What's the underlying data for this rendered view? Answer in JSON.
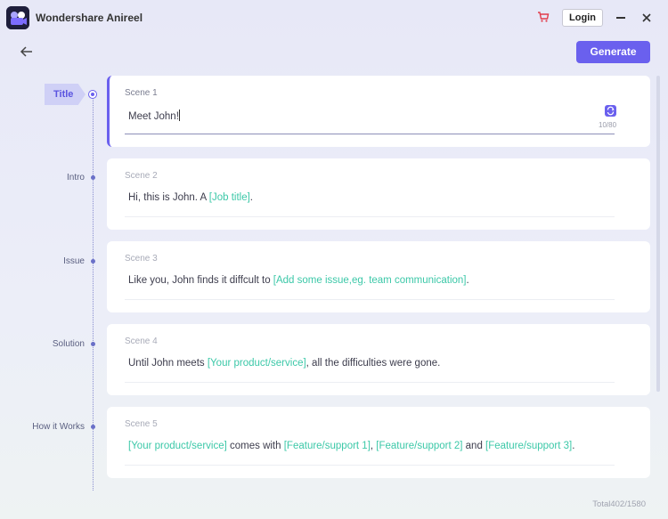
{
  "app": {
    "title": "Wondershare Anireel"
  },
  "header": {
    "login_label": "Login",
    "generate_label": "Generate"
  },
  "timeline": {
    "items": [
      {
        "label": "Title",
        "active": true
      },
      {
        "label": "Intro"
      },
      {
        "label": "Issue"
      },
      {
        "label": "Solution"
      },
      {
        "label": "How it Works"
      }
    ]
  },
  "scenes": [
    {
      "label": "Scene 1",
      "text": "Meet John!",
      "counter": "10/80"
    },
    {
      "label": "Scene 2",
      "parts": [
        "Hi, this is John. A ",
        "[Job title]",
        "."
      ]
    },
    {
      "label": "Scene 3",
      "parts": [
        "Like you, John finds it diffcult to ",
        "[Add some issue,eg. team communication]",
        "."
      ]
    },
    {
      "label": "Scene 4",
      "parts": [
        "Until John meets ",
        "[Your product/service]",
        ", all the difficulties were gone."
      ]
    },
    {
      "label": "Scene 5",
      "parts": [
        "[Your product/service]",
        " comes with ",
        "[Feature/support 1]",
        ", ",
        "[Feature/support 2]",
        " and ",
        "[Feature/support 3]",
        "."
      ]
    }
  ],
  "footer": {
    "total": "Total402/1580"
  },
  "colors": {
    "accent": "#6a60ee",
    "placeholder": "#3cc8a8"
  }
}
